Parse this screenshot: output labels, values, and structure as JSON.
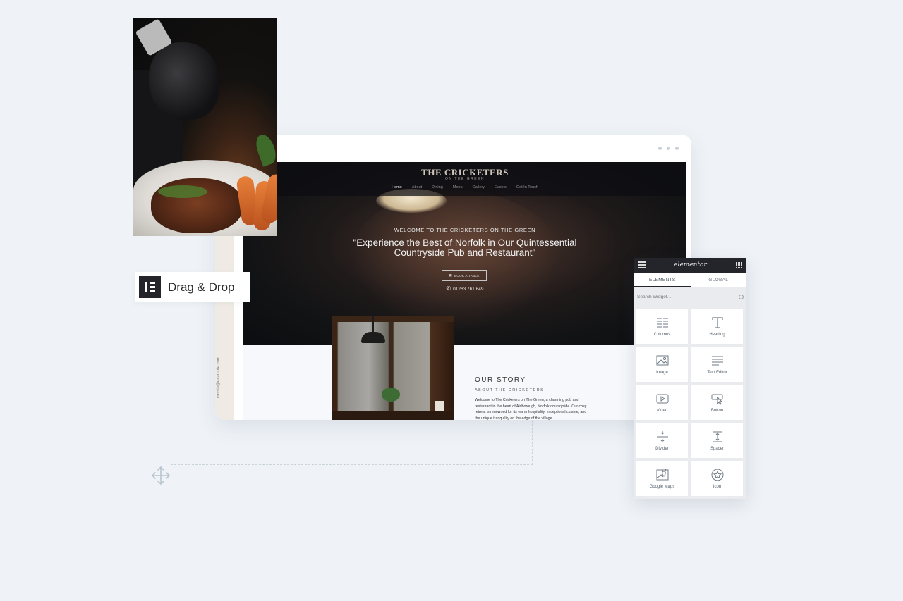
{
  "badge": {
    "label": "Drag & Drop",
    "icon": "elementor-logo-icon"
  },
  "website": {
    "brand": "THE CRICKETERS",
    "brand_sub": "ON THE GREEN",
    "nav": [
      "Home",
      "About",
      "Dining",
      "Menu",
      "Gallery",
      "Events",
      "Get In Touch"
    ],
    "nav_active": "Home",
    "welcome": "WELCOME TO THE CRICKETERS ON THE GREEN",
    "headline": "\"Experience the Best of Norfolk in Our Quintessential Countryside Pub and Restaurant\"",
    "book_button": "BOOK A TABLE",
    "phone": "01263 761 649",
    "side_email": "cassie@example.com",
    "story_title": "OUR STORY",
    "story_subtitle": "ABOUT THE CRICKETERS",
    "story_body": "Welcome to The Cricketers on The Green, a charming pub and restaurant in the heart of Aldborough, Norfolk countryside. Our cosy retreat is renowned for its warm hospitality, exceptional cuisine, and the unique tranquility on the edge of the village."
  },
  "panel": {
    "logo": "elementor",
    "tabs": [
      "ELEMENTS",
      "GLOBAL"
    ],
    "active_tab": "ELEMENTS",
    "search_placeholder": "Search Widget...",
    "widgets": [
      {
        "label": "Columns",
        "icon": "columns-icon"
      },
      {
        "label": "Heading",
        "icon": "heading-icon"
      },
      {
        "label": "Image",
        "icon": "image-icon"
      },
      {
        "label": "Text Editor",
        "icon": "text-editor-icon"
      },
      {
        "label": "Video",
        "icon": "video-icon"
      },
      {
        "label": "Button",
        "icon": "button-icon"
      },
      {
        "label": "Divider",
        "icon": "divider-icon"
      },
      {
        "label": "Spacer",
        "icon": "spacer-icon"
      },
      {
        "label": "Google Maps",
        "icon": "google-maps-icon"
      },
      {
        "label": "Icon",
        "icon": "star-icon"
      }
    ]
  },
  "colors": {
    "background": "#eff3f7",
    "panel_dark": "#23252b",
    "accent_text": "#2a2a2a"
  }
}
